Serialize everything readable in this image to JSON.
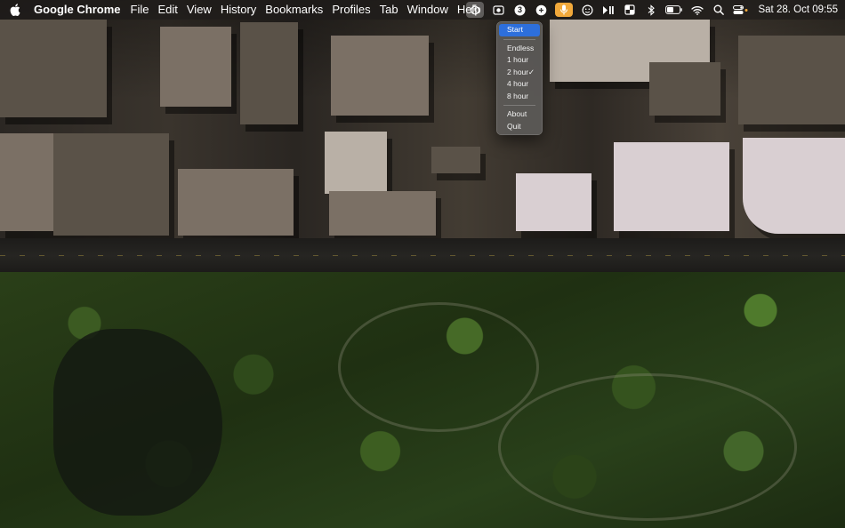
{
  "menubar": {
    "app_name": "Google Chrome",
    "menus": [
      "File",
      "Edit",
      "View",
      "History",
      "Bookmarks",
      "Profiles",
      "Tab",
      "Window",
      "Help"
    ],
    "status_icons": [
      "timer-icon",
      "screenshot-icon",
      "badge-3-icon",
      "audio-icon",
      "microphone-icon",
      "face-icon",
      "play-pause-icon",
      "window-icon",
      "bluetooth-icon",
      "battery-icon",
      "wifi-icon",
      "search-icon",
      "control-center-icon"
    ],
    "badge_number": "3",
    "clock": "Sat 28. Oct  09:55"
  },
  "dropdown": {
    "start": "Start",
    "durations": [
      "Endless",
      "1 hour",
      "2 hour",
      "4 hour",
      "8 hour"
    ],
    "checked": "2 hour",
    "check_mark": "✓",
    "about": "About",
    "quit": "Quit",
    "accent_color": "#2d6fdc"
  }
}
